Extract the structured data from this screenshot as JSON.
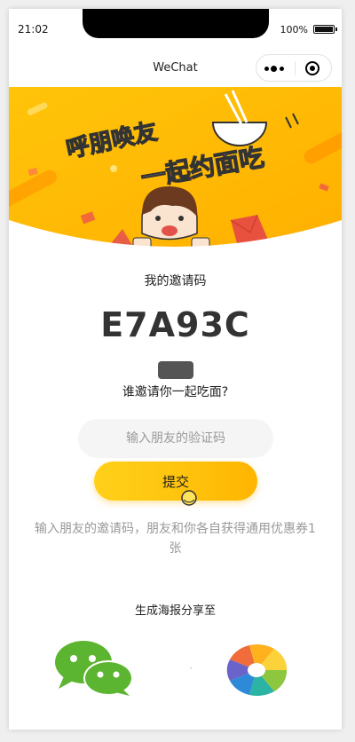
{
  "status_bar": {
    "time": "21:02",
    "battery": "100%"
  },
  "nav": {
    "title": "WeChat"
  },
  "banner": {
    "line1": "呼朋唤友",
    "line2": "一起约面吃"
  },
  "invite": {
    "label": "我的邀请码",
    "code": "E7A93C",
    "question": "谁邀请你一起吃面?"
  },
  "form": {
    "input_placeholder": "输入朋友的验证码",
    "submit_label": "提交",
    "hint_line1": "输入朋友的邀请码，朋友和你各自获得通用优惠券1",
    "hint_line2": "张"
  },
  "share": {
    "label": "生成海报分享至"
  },
  "colors": {
    "accent": "#ffc20c",
    "wechat": "#5cb531"
  }
}
